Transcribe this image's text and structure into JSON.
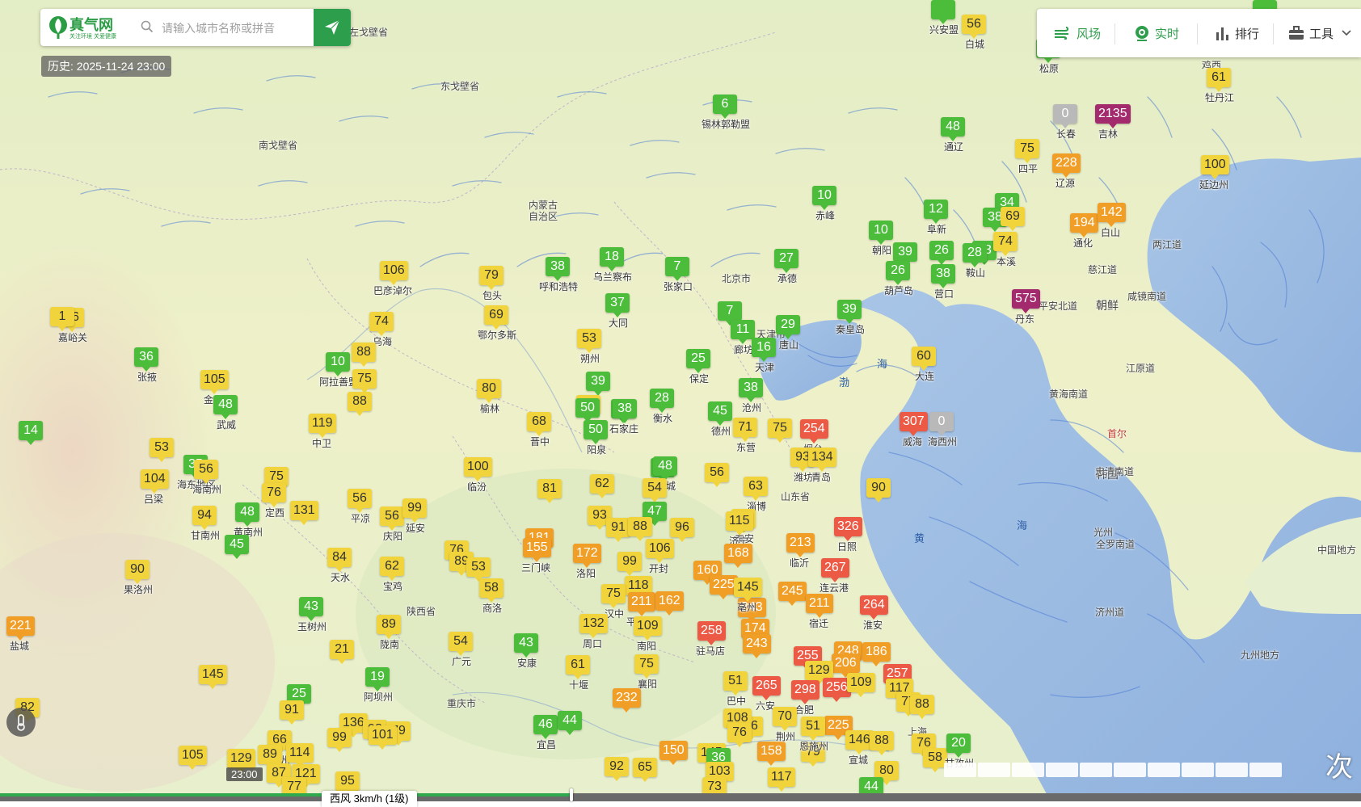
{
  "app": {
    "logo_name": "真气网",
    "logo_slogan": "关注环境 关爱健康",
    "search_placeholder": "请输入城市名称或拼音",
    "history_label": "历史: 2025-11-24 23:00"
  },
  "toolbar": {
    "items": [
      {
        "label": "风场",
        "icon": "wind-icon",
        "active": true
      },
      {
        "label": "实时",
        "icon": "realtime-icon",
        "active": true
      },
      {
        "label": "排行",
        "icon": "ranking-icon",
        "active": false
      },
      {
        "label": "工具",
        "icon": "toolbox-icon",
        "active": false
      }
    ]
  },
  "footer": {
    "time_label": "23:00",
    "wind_label": "西风 3km/h (1级)",
    "timeline_progress": 0.42,
    "corner_text": "次"
  },
  "colors": {
    "good": "#4cbd3b",
    "moderate": "#f1d43b",
    "light": "#f19e27",
    "medium": "#ec5a45",
    "heavy": "#a32a6c",
    "nodata": "#b9b9b9",
    "brand": "#2d9e4c"
  },
  "places": [
    {
      "name": "左戈壁省",
      "sea": false
    },
    {
      "name": "东戈壁省",
      "sea": false
    },
    {
      "name": "南戈壁省",
      "sea": false
    },
    {
      "name": "内蒙古",
      "sea": false
    },
    {
      "name": "自治区",
      "sea": false
    },
    {
      "name": "陕西省",
      "sea": false
    },
    {
      "name": "山东省",
      "sea": false
    },
    {
      "name": "北京市",
      "sea": false
    },
    {
      "name": "天津市",
      "sea": false
    },
    {
      "name": "重庆市",
      "sea": false
    },
    {
      "name": "海",
      "sea": true
    },
    {
      "name": "渤",
      "sea": true
    },
    {
      "name": "黄",
      "sea": true
    },
    {
      "name": "海",
      "sea": true
    },
    {
      "name": "朝鲜",
      "sea": false
    },
    {
      "name": "韩国",
      "sea": false
    },
    {
      "name": "江原道",
      "sea": false
    },
    {
      "name": "黄海南道",
      "sea": false
    },
    {
      "name": "平安北道",
      "sea": false
    },
    {
      "name": "咸镜南道",
      "sea": false
    },
    {
      "name": "两江道",
      "sea": false
    },
    {
      "name": "慈江道",
      "sea": false
    },
    {
      "name": "忠清南道",
      "sea": false
    },
    {
      "name": "全罗南道",
      "sea": false
    },
    {
      "name": "济州道",
      "sea": false
    },
    {
      "name": "光州",
      "sea": false
    },
    {
      "name": "首尔",
      "sea": false
    },
    {
      "name": "中国地方",
      "sea": false
    },
    {
      "name": "九州地方",
      "sea": false
    },
    {
      "name": "鸡西",
      "sea": false
    },
    {
      "name": "上海",
      "sea": false
    },
    {
      "name": "海市",
      "sea": false
    }
  ],
  "stations": [
    {
      "city": "兴安盟",
      "aqi": "",
      "level": "good"
    },
    {
      "city": "白城",
      "aqi": "56",
      "level": "moderate"
    },
    {
      "city": "松原",
      "aqi": "",
      "level": "good"
    },
    {
      "city": "鸡西",
      "aqi": "",
      "level": "good"
    },
    {
      "city": "牡丹江",
      "aqi": "61",
      "level": "moderate"
    },
    {
      "city": "长春",
      "aqi": "0",
      "level": "nodata"
    },
    {
      "city": "吉林",
      "aqi": "2135",
      "level": "heavy"
    },
    {
      "city": "锡林郭勒盟",
      "aqi": "6",
      "level": "good"
    },
    {
      "city": "通辽",
      "aqi": "48",
      "level": "good"
    },
    {
      "city": "四平",
      "aqi": "75",
      "level": "moderate"
    },
    {
      "city": "辽源",
      "aqi": "228",
      "level": "light"
    },
    {
      "city": "延边州",
      "aqi": "100",
      "level": "moderate"
    },
    {
      "city": "赤峰",
      "aqi": "10",
      "level": "good"
    },
    {
      "city": "阜新",
      "aqi": "12",
      "level": "good"
    },
    {
      "city": "",
      "aqi": "34",
      "level": "good"
    },
    {
      "city": "",
      "aqi": "38",
      "level": "good"
    },
    {
      "city": "",
      "aqi": "69",
      "level": "moderate"
    },
    {
      "city": "通化",
      "aqi": "194",
      "level": "light"
    },
    {
      "city": "白山",
      "aqi": "142",
      "level": "light"
    },
    {
      "city": "朝阳",
      "aqi": "10",
      "level": "good"
    },
    {
      "city": "",
      "aqi": "39",
      "level": "good"
    },
    {
      "city": "",
      "aqi": "26",
      "level": "good"
    },
    {
      "city": "",
      "aqi": "33",
      "level": "good"
    },
    {
      "city": "本溪",
      "aqi": "74",
      "level": "moderate"
    },
    {
      "city": "鞍山",
      "aqi": "28",
      "level": "good"
    },
    {
      "city": "葫芦岛",
      "aqi": "26",
      "level": "good"
    },
    {
      "city": "营口",
      "aqi": "38",
      "level": "good"
    },
    {
      "city": "丹东",
      "aqi": "575",
      "level": "heavy"
    },
    {
      "city": "呼和浩特",
      "aqi": "38",
      "level": "good"
    },
    {
      "city": "乌兰察布",
      "aqi": "18",
      "level": "good"
    },
    {
      "city": "张家口",
      "aqi": "7",
      "level": "good"
    },
    {
      "city": "承德",
      "aqi": "27",
      "level": "good"
    },
    {
      "city": "巴彦淖尔",
      "aqi": "106",
      "level": "moderate"
    },
    {
      "city": "包头",
      "aqi": "79",
      "level": "moderate"
    },
    {
      "city": "鄂尔多斯",
      "aqi": "69",
      "level": "moderate"
    },
    {
      "city": "大同",
      "aqi": "37",
      "level": "good"
    },
    {
      "city": "",
      "aqi": "7",
      "level": "good"
    },
    {
      "city": "廊坊",
      "aqi": "11",
      "level": "good"
    },
    {
      "city": "唐山",
      "aqi": "29",
      "level": "good"
    },
    {
      "city": "秦皇岛",
      "aqi": "39",
      "level": "good"
    },
    {
      "city": "天津",
      "aqi": "16",
      "level": "good"
    },
    {
      "city": "大连",
      "aqi": "60",
      "level": "moderate"
    },
    {
      "city": "嘉峪关",
      "aqi": "56",
      "level": "moderate"
    },
    {
      "city": "",
      "aqi": "1",
      "level": "moderate"
    },
    {
      "city": "乌海",
      "aqi": "74",
      "level": "moderate"
    },
    {
      "city": "张掖",
      "aqi": "36",
      "level": "good"
    },
    {
      "city": "阿拉善盟",
      "aqi": "10",
      "level": "good"
    },
    {
      "city": "",
      "aqi": "88",
      "level": "moderate"
    },
    {
      "city": "",
      "aqi": "75",
      "level": "moderate"
    },
    {
      "city": "朔州",
      "aqi": "53",
      "level": "moderate"
    },
    {
      "city": "保定",
      "aqi": "25",
      "level": "good"
    },
    {
      "city": "沧州",
      "aqi": "38",
      "level": "good"
    },
    {
      "city": "",
      "aqi": "88",
      "level": "moderate"
    },
    {
      "city": "金昌",
      "aqi": "105",
      "level": "moderate"
    },
    {
      "city": "武威",
      "aqi": "48",
      "level": "good"
    },
    {
      "city": "中卫",
      "aqi": "119",
      "level": "moderate"
    },
    {
      "city": "榆林",
      "aqi": "80",
      "level": "moderate"
    },
    {
      "city": "",
      "aqi": "39",
      "level": "good"
    },
    {
      "city": "",
      "aqi": "68",
      "level": "moderate"
    },
    {
      "city": "",
      "aqi": "50",
      "level": "good"
    },
    {
      "city": "石家庄",
      "aqi": "39",
      "level": "good"
    },
    {
      "city": "衡水",
      "aqi": "28",
      "level": "good"
    },
    {
      "city": "德州",
      "aqi": "45",
      "level": "good"
    },
    {
      "city": "东营",
      "aqi": "71",
      "level": "moderate"
    },
    {
      "city": "",
      "aqi": "75",
      "level": "moderate"
    },
    {
      "city": "烟台",
      "aqi": "254",
      "level": "medium"
    },
    {
      "city": "威海",
      "aqi": "307",
      "level": "medium"
    },
    {
      "city": "海西州",
      "aqi": "0",
      "level": "nodata"
    },
    {
      "city": "",
      "aqi": "14",
      "level": "good"
    },
    {
      "city": "",
      "aqi": "53",
      "level": "moderate"
    },
    {
      "city": "海东地区",
      "aqi": "35",
      "level": "good"
    },
    {
      "city": "海南州",
      "aqi": "56",
      "level": "moderate"
    },
    {
      "city": "吕梁",
      "aqi": "104",
      "level": "moderate"
    },
    {
      "city": "晋中",
      "aqi": "68",
      "level": "moderate"
    },
    {
      "city": "阳泉",
      "aqi": "50",
      "level": "good"
    },
    {
      "city": "",
      "aqi": "38",
      "level": "good"
    },
    {
      "city": "",
      "aqi": "30",
      "level": "good"
    },
    {
      "city": "聊城",
      "aqi": "48",
      "level": "good"
    },
    {
      "city": "",
      "aqi": "56",
      "level": "moderate"
    },
    {
      "city": "淄博",
      "aqi": "63",
      "level": "moderate"
    },
    {
      "city": "潍坊",
      "aqi": "93",
      "level": "moderate"
    },
    {
      "city": "青岛",
      "aqi": "134",
      "level": "moderate"
    },
    {
      "city": "",
      "aqi": "90",
      "level": "moderate"
    },
    {
      "city": "",
      "aqi": "75",
      "level": "moderate"
    },
    {
      "city": "定西",
      "aqi": "76",
      "level": "moderate"
    },
    {
      "city": "",
      "aqi": "131",
      "level": "moderate"
    },
    {
      "city": "黄南州",
      "aqi": "48",
      "level": "good"
    },
    {
      "city": "甘南州",
      "aqi": "94",
      "level": "moderate"
    },
    {
      "city": "",
      "aqi": "45",
      "level": "good"
    },
    {
      "city": "平凉",
      "aqi": "56",
      "level": "moderate"
    },
    {
      "city": "庆阳",
      "aqi": "56",
      "level": "moderate"
    },
    {
      "city": "延安",
      "aqi": "99",
      "level": "moderate"
    },
    {
      "city": "临汾",
      "aqi": "100",
      "level": "moderate"
    },
    {
      "city": "",
      "aqi": "81",
      "level": "moderate"
    },
    {
      "city": "",
      "aqi": "62",
      "level": "moderate"
    },
    {
      "city": "",
      "aqi": "54",
      "level": "moderate"
    },
    {
      "city": "",
      "aqi": "47",
      "level": "good"
    },
    {
      "city": "泰安",
      "aqi": "69",
      "level": "moderate"
    },
    {
      "city": "日照",
      "aqi": "326",
      "level": "medium"
    },
    {
      "city": "",
      "aqi": "93",
      "level": "moderate"
    },
    {
      "city": "",
      "aqi": "91",
      "level": "moderate"
    },
    {
      "city": "",
      "aqi": "88",
      "level": "moderate"
    },
    {
      "city": "",
      "aqi": "96",
      "level": "moderate"
    },
    {
      "city": "济宁",
      "aqi": "115",
      "level": "moderate"
    },
    {
      "city": "临沂",
      "aqi": "213",
      "level": "light"
    },
    {
      "city": "果洛州",
      "aqi": "90",
      "level": "moderate"
    },
    {
      "city": "天水",
      "aqi": "84",
      "level": "moderate"
    },
    {
      "city": "宝鸡",
      "aqi": "62",
      "level": "moderate"
    },
    {
      "city": "",
      "aqi": "76",
      "level": "moderate"
    },
    {
      "city": "",
      "aqi": "89",
      "level": "moderate"
    },
    {
      "city": "",
      "aqi": "53",
      "level": "moderate"
    },
    {
      "city": "",
      "aqi": "181",
      "level": "light"
    },
    {
      "city": "三门峡",
      "aqi": "155",
      "level": "light"
    },
    {
      "city": "洛阳",
      "aqi": "172",
      "level": "light"
    },
    {
      "city": "",
      "aqi": "99",
      "level": "moderate"
    },
    {
      "city": "开封",
      "aqi": "106",
      "level": "moderate"
    },
    {
      "city": "",
      "aqi": "160",
      "level": "light"
    },
    {
      "city": "",
      "aqi": "168",
      "level": "light"
    },
    {
      "city": "连云港",
      "aqi": "267",
      "level": "medium"
    },
    {
      "city": "商洛",
      "aqi": "58",
      "level": "moderate"
    },
    {
      "city": "",
      "aqi": "118",
      "level": "moderate"
    },
    {
      "city": "",
      "aqi": "225",
      "level": "light"
    },
    {
      "city": "",
      "aqi": "243",
      "level": "light"
    },
    {
      "city": "亳州",
      "aqi": "145",
      "level": "moderate"
    },
    {
      "city": "",
      "aqi": "245",
      "level": "light"
    },
    {
      "city": "宿迁",
      "aqi": "211",
      "level": "light"
    },
    {
      "city": "淮安",
      "aqi": "264",
      "level": "medium"
    },
    {
      "city": "盐城",
      "aqi": "221",
      "level": "light"
    },
    {
      "city": "玉树州",
      "aqi": "43",
      "level": "good"
    },
    {
      "city": "陇南",
      "aqi": "89",
      "level": "moderate"
    },
    {
      "city": "汉中",
      "aqi": "75",
      "level": "moderate"
    },
    {
      "city": "平顶山",
      "aqi": "211",
      "level": "light"
    },
    {
      "city": "",
      "aqi": "162",
      "level": "light"
    },
    {
      "city": "周口",
      "aqi": "132",
      "level": "moderate"
    },
    {
      "city": "南阳",
      "aqi": "109",
      "level": "moderate"
    },
    {
      "city": "驻马店",
      "aqi": "258",
      "level": "medium"
    },
    {
      "city": "阜阳",
      "aqi": "174",
      "level": "light"
    },
    {
      "city": "",
      "aqi": "243",
      "level": "light"
    },
    {
      "city": "",
      "aqi": "255",
      "level": "medium"
    },
    {
      "city": "",
      "aqi": "248",
      "level": "light"
    },
    {
      "city": "",
      "aqi": "186",
      "level": "light"
    },
    {
      "city": "",
      "aqi": "21",
      "level": "moderate"
    },
    {
      "city": "广元",
      "aqi": "54",
      "level": "moderate"
    },
    {
      "city": "安康",
      "aqi": "43",
      "level": "good"
    },
    {
      "city": "十堰",
      "aqi": "61",
      "level": "moderate"
    },
    {
      "city": "襄阳",
      "aqi": "75",
      "level": "moderate"
    },
    {
      "city": "信阳",
      "aqi": "206",
      "level": "light"
    },
    {
      "city": "",
      "aqi": "129",
      "level": "moderate"
    },
    {
      "city": "",
      "aqi": "257",
      "level": "medium"
    },
    {
      "city": "",
      "aqi": "145",
      "level": "moderate"
    },
    {
      "city": "阿坝州",
      "aqi": "19",
      "level": "good"
    },
    {
      "city": "巴中",
      "aqi": "51",
      "level": "moderate"
    },
    {
      "city": "六安",
      "aqi": "265",
      "level": "medium"
    },
    {
      "city": "合肥",
      "aqi": "298",
      "level": "medium"
    },
    {
      "city": "",
      "aqi": "256",
      "level": "medium"
    },
    {
      "city": "",
      "aqi": "109",
      "level": "moderate"
    },
    {
      "city": "",
      "aqi": "117",
      "level": "moderate"
    },
    {
      "city": "",
      "aqi": "232",
      "level": "light"
    },
    {
      "city": "",
      "aqi": "77",
      "level": "moderate"
    },
    {
      "city": "",
      "aqi": "88",
      "level": "moderate"
    },
    {
      "city": "",
      "aqi": "82",
      "level": "moderate"
    },
    {
      "city": "",
      "aqi": "25",
      "level": "good"
    },
    {
      "city": "",
      "aqi": "91",
      "level": "moderate"
    },
    {
      "city": "",
      "aqi": "136",
      "level": "moderate"
    },
    {
      "city": "",
      "aqi": "98",
      "level": "moderate"
    },
    {
      "city": "",
      "aqi": "79",
      "level": "moderate"
    },
    {
      "city": "达州",
      "aqi": "66",
      "level": "moderate"
    },
    {
      "city": "",
      "aqi": "99",
      "level": "moderate"
    },
    {
      "city": "",
      "aqi": "101",
      "level": "moderate"
    },
    {
      "city": "宜昌",
      "aqi": "46",
      "level": "good"
    },
    {
      "city": "",
      "aqi": "44",
      "level": "good"
    },
    {
      "city": "",
      "aqi": "86",
      "level": "moderate"
    },
    {
      "city": "",
      "aqi": "108",
      "level": "moderate"
    },
    {
      "city": "",
      "aqi": "158",
      "level": "light"
    },
    {
      "city": "",
      "aqi": "225",
      "level": "light"
    },
    {
      "city": "宣城",
      "aqi": "146",
      "level": "moderate"
    },
    {
      "city": "",
      "aqi": "88",
      "level": "moderate"
    },
    {
      "city": "",
      "aqi": "79",
      "level": "moderate"
    },
    {
      "city": "荆州",
      "aqi": "70",
      "level": "moderate"
    },
    {
      "city": "恩施州",
      "aqi": "51",
      "level": "moderate"
    },
    {
      "city": "",
      "aqi": "150",
      "level": "light"
    },
    {
      "city": "",
      "aqi": "145",
      "level": "moderate"
    },
    {
      "city": "",
      "aqi": "36",
      "level": "good"
    },
    {
      "city": "",
      "aqi": "76",
      "level": "moderate"
    },
    {
      "city": "",
      "aqi": "76",
      "level": "moderate"
    },
    {
      "city": "",
      "aqi": "58",
      "level": "moderate"
    },
    {
      "city": "甘孜州",
      "aqi": "20",
      "level": "good"
    },
    {
      "city": "",
      "aqi": "105",
      "level": "moderate"
    },
    {
      "city": "",
      "aqi": "129",
      "level": "moderate"
    },
    {
      "city": "",
      "aqi": "89",
      "level": "moderate"
    },
    {
      "city": "",
      "aqi": "114",
      "level": "moderate"
    },
    {
      "city": "",
      "aqi": "87",
      "level": "moderate"
    },
    {
      "city": "",
      "aqi": "121",
      "level": "moderate"
    },
    {
      "city": "",
      "aqi": "77",
      "level": "moderate"
    },
    {
      "city": "",
      "aqi": "95",
      "level": "moderate"
    },
    {
      "city": "",
      "aqi": "92",
      "level": "moderate"
    },
    {
      "city": "",
      "aqi": "65",
      "level": "moderate"
    },
    {
      "city": "",
      "aqi": "103",
      "level": "moderate"
    },
    {
      "city": "",
      "aqi": "117",
      "level": "moderate"
    },
    {
      "city": "",
      "aqi": "80",
      "level": "moderate"
    },
    {
      "city": "",
      "aqi": "44",
      "level": "good"
    },
    {
      "city": "",
      "aqi": "73",
      "level": "moderate"
    }
  ]
}
